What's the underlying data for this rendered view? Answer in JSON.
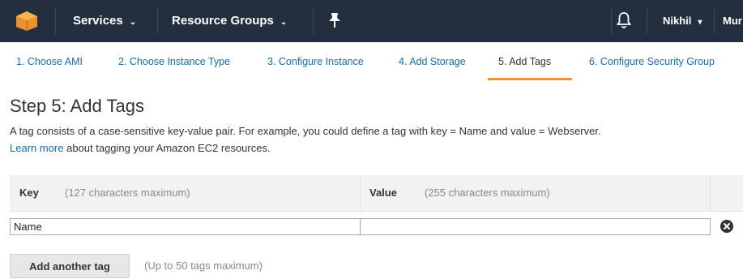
{
  "nav": {
    "services_label": "Services",
    "resource_groups_label": "Resource Groups",
    "user_label": "Nikhil",
    "region_label": "Mur",
    "caret": "⌄",
    "user_caret": "▾",
    "logo_icon": "aws-cube-icon",
    "pin_icon": "pin-icon",
    "bell_icon": "bell-icon",
    "background_color": "#232f3e",
    "logo_color": "#ec912d"
  },
  "wizard": {
    "tabs": [
      {
        "label": "1. Choose AMI",
        "active": false
      },
      {
        "label": "2. Choose Instance Type",
        "active": false
      },
      {
        "label": "3. Configure Instance",
        "active": false
      },
      {
        "label": "4. Add Storage",
        "active": false
      },
      {
        "label": "5. Add Tags",
        "active": true
      },
      {
        "label": "6. Configure Security Group",
        "active": false
      }
    ],
    "active_underline_color": "#ec912d",
    "link_color": "#1a6aa8"
  },
  "page": {
    "title": "Step 5: Add Tags",
    "description": "A tag consists of a case-sensitive key-value pair. For example, you could define a tag with key = Name and value = Webserver.",
    "learn_more_link": "Learn more",
    "learn_more_suffix": " about tagging your Amazon EC2 resources."
  },
  "tags_table": {
    "key_header": "Key",
    "key_hint": "(127 characters maximum)",
    "value_header": "Value",
    "value_hint": "(255 characters maximum)",
    "rows": [
      {
        "key": "Name",
        "value": ""
      }
    ],
    "remove_icon": "remove-circle-icon"
  },
  "actions": {
    "add_tag_label": "Add another tag",
    "add_tag_hint": "(Up to 50 tags maximum)"
  }
}
